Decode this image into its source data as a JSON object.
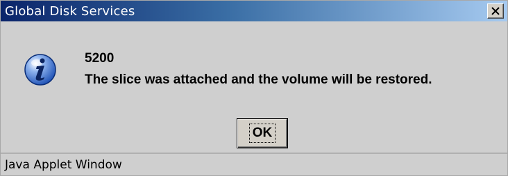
{
  "window": {
    "title": "Global Disk Services",
    "close_label": "×"
  },
  "message": {
    "icon": "info-icon",
    "code": "5200",
    "text": "The slice was attached and the volume will be restored."
  },
  "buttons": {
    "ok_label": "OK"
  },
  "statusbar": {
    "text": "Java Applet Window"
  },
  "colors": {
    "titlebar_start": "#0a246a",
    "titlebar_end": "#a6caf0",
    "background": "#cfcfcf",
    "icon_blue": "#2a62c8"
  }
}
